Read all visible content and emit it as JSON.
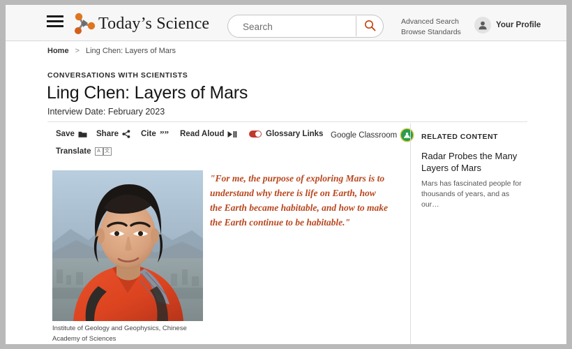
{
  "header": {
    "menu_icon": "hamburger-menu-icon",
    "logo_icon": "molecule-logo-icon",
    "brand": "Today’s Science",
    "search": {
      "value": "",
      "placeholder": "Search",
      "button_icon": "search-icon"
    },
    "links": [
      {
        "label": "Advanced Search"
      },
      {
        "label": "Browse Standards"
      }
    ],
    "profile": {
      "avatar_icon": "user-avatar-icon",
      "label": "Your Profile"
    }
  },
  "breadcrumb": {
    "home": "Home",
    "separator": ">",
    "current": "Ling Chen: Layers of Mars"
  },
  "article": {
    "kicker": "CONVERSATIONS WITH SCIENTISTS",
    "title": "Ling Chen: Layers of Mars",
    "subtitle": "Interview Date: February 2023",
    "pullquote": "\"For me, the purpose of exploring Mars is to understand why there is life on Earth, how the Earth became habitable, and how to make the Earth continue to be habitable.\"",
    "photo_caption": "Institute of Geology and Geophysics, Chinese Academy of Sciences"
  },
  "toolbar": {
    "save": {
      "label": "Save",
      "icon": "folder-icon"
    },
    "share": {
      "label": "Share",
      "icon": "share-nodes-icon"
    },
    "cite": {
      "label": "Cite",
      "icon": "quotation-marks-icon"
    },
    "read_aloud": {
      "label": "Read Aloud",
      "icon": "play-pause-icon"
    },
    "glossary": {
      "label": "Glossary Links",
      "icon": "toggle-on-icon",
      "state": "on"
    },
    "google_classroom": {
      "label": "Google Classroom",
      "icon": "google-classroom-icon"
    },
    "translate": {
      "label": "Translate",
      "icon": "translate-icon",
      "glyph_a": "A",
      "glyph_b": "文"
    }
  },
  "sidebar": {
    "heading": "RELATED CONTENT",
    "items": [
      {
        "title": "Radar Probes the Many Layers of Mars",
        "desc": "Mars has fascinated people for thousands of years, and as our…"
      }
    ]
  },
  "colors": {
    "accent_orange": "#D2601A",
    "quote_orange": "#B8471F",
    "toggle_on": "#C0392B",
    "classroom_green": "#2A9D4E",
    "header_bg": "#F7F7F7",
    "page_frame": "#B9B9B9"
  }
}
